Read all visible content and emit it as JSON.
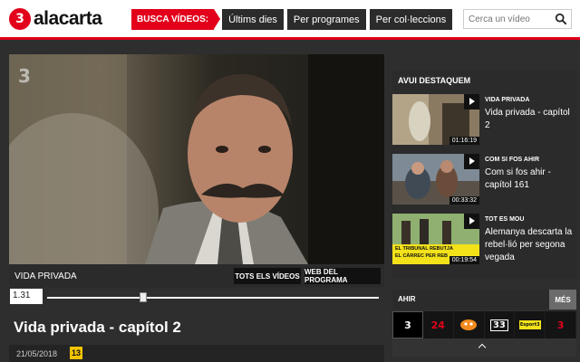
{
  "header": {
    "logo_text": "alacarta",
    "logo_mark": "3",
    "nav_busca": "BUSCA VÍDEOS:",
    "nav": [
      "Últims dies",
      "Per programes",
      "Per col·leccions"
    ],
    "search_placeholder": "Cerca un vídeo",
    "accent": "#e2001a"
  },
  "player": {
    "watermark": "3",
    "program_name": "VIDA PRIVADA",
    "btn_all_videos": "TOTS ELS VÍDEOS",
    "btn_program_site": "WEB DEL PROGRAMA",
    "current_time": "1.31",
    "progress_fraction": 0.29,
    "episode_title": "Vida privada - capítol 2",
    "date": "21/05/2018",
    "rating": "13"
  },
  "sidebar": {
    "title": "AVUI DESTAQUEM",
    "items": [
      {
        "category": "VIDA PRIVADA",
        "title": "Vida privada - capítol 2",
        "duration": "01:16:19"
      },
      {
        "category": "COM SI FOS AHIR",
        "title": "Com si fos ahir - capítol 161",
        "duration": "00:33:32"
      },
      {
        "category": "TOT ES MOU",
        "title": "Alemanya descarta la rebel·lió per segona vegada",
        "duration": "00:19:54",
        "overlay_line1": "EL TRIBUNAL REBUTJA",
        "overlay_line2": "EL CÀRREC PER REB"
      }
    ]
  },
  "ahir": {
    "label": "AHIR",
    "more": "MÉS",
    "channels": [
      "3",
      "24",
      "33",
      "33",
      "Esport3",
      "3"
    ]
  }
}
